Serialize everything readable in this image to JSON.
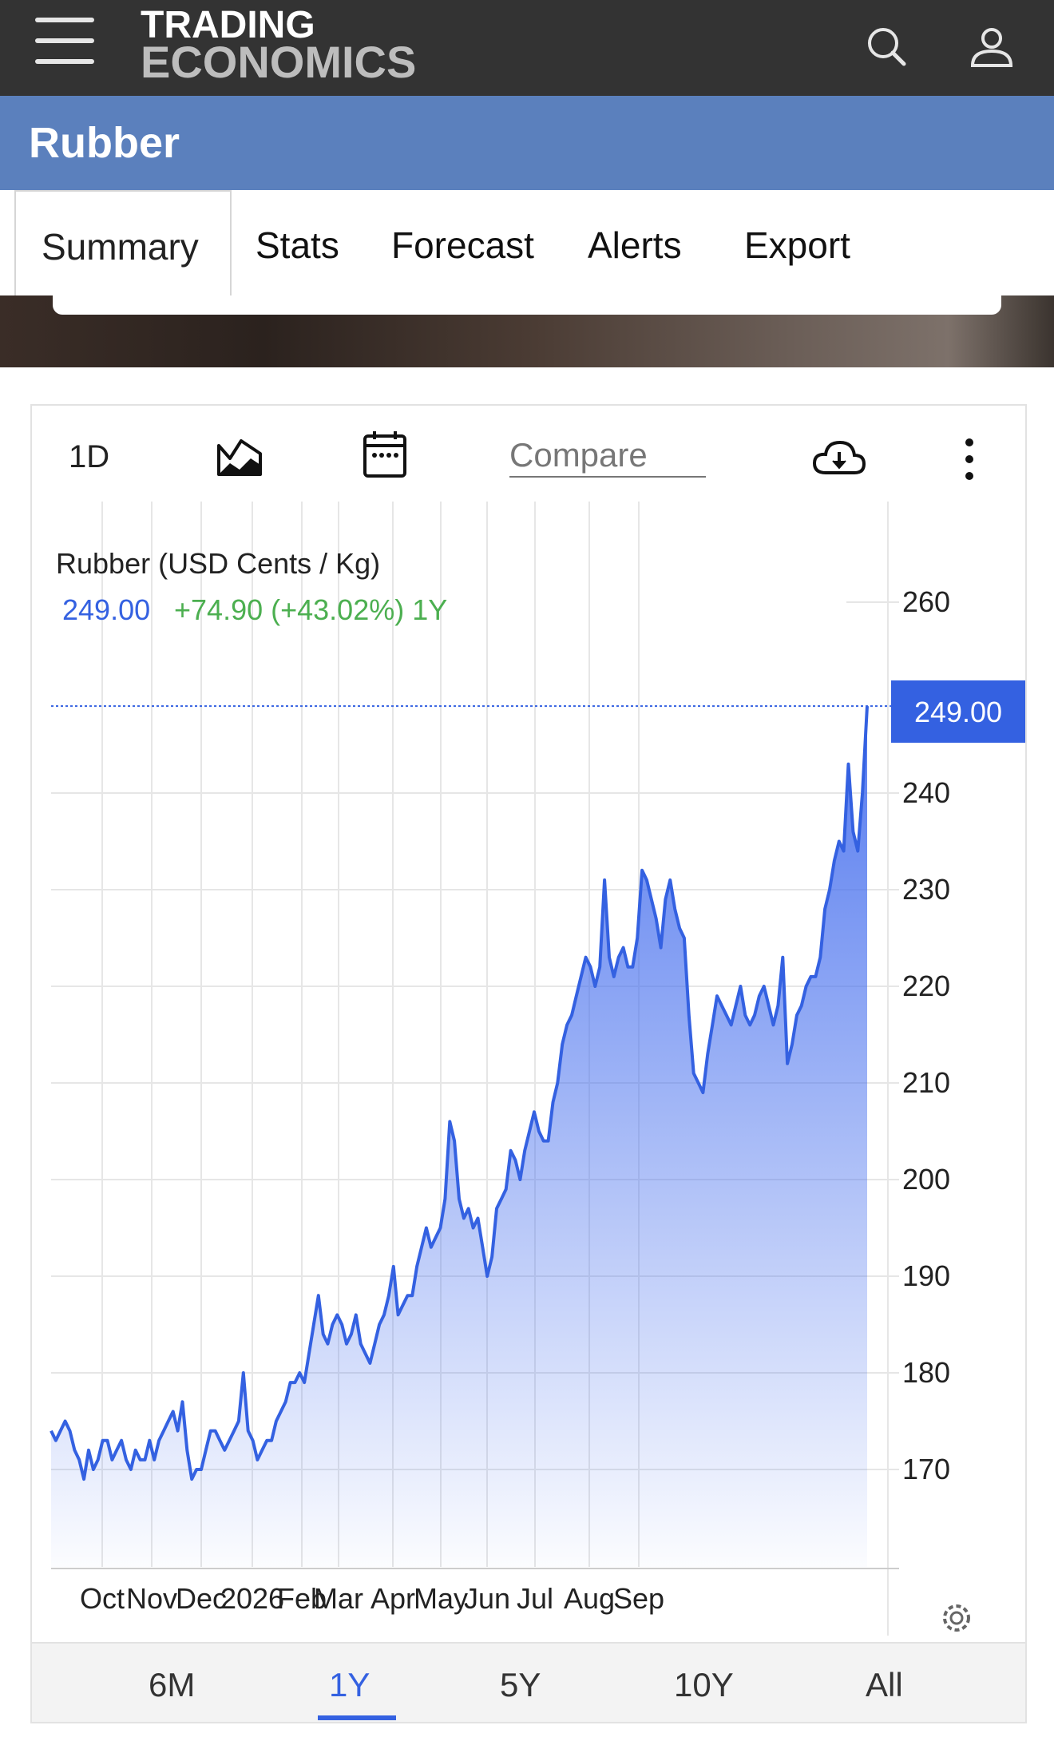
{
  "header": {
    "logo_line1": "TRADING",
    "logo_line2": "ECONOMICS"
  },
  "page_title": "Rubber",
  "tabs": [
    "Summary",
    "Stats",
    "Forecast",
    "Alerts",
    "Export"
  ],
  "toolbar": {
    "period_label": "1D",
    "compare_placeholder": "Compare"
  },
  "chart_info": {
    "series_name": "Rubber (USD Cents / Kg)",
    "last_value": "249.00",
    "change_text": "+74.90 (+43.02%) 1Y",
    "price_tag": "249.00"
  },
  "ranges": [
    "6M",
    "1Y",
    "5Y",
    "10Y",
    "All"
  ],
  "active_range": "1Y",
  "colors": {
    "accent": "#3461e1",
    "positive": "#4caf50",
    "title_bar": "#5b80bd"
  },
  "chart_data": {
    "type": "area",
    "title": "Rubber (USD Cents / Kg)",
    "xlabel": "",
    "ylabel": "",
    "x_ticks": [
      "Oct",
      "Nov",
      "Dec",
      "2026",
      "Feb",
      "Mar",
      "Apr",
      "May",
      "Jun",
      "Jul",
      "Aug",
      "Sep"
    ],
    "y_ticks": [
      170,
      180,
      190,
      200,
      210,
      220,
      230,
      240,
      260
    ],
    "ylim": [
      160,
      265
    ],
    "grid": true,
    "last_value": 249.0,
    "series": [
      {
        "values": [
          174,
          173,
          174,
          175,
          174,
          172,
          171,
          169,
          172,
          170,
          171,
          173,
          173,
          171,
          172,
          173,
          171,
          170,
          172,
          171,
          171,
          173,
          171,
          173,
          174,
          175,
          176,
          174,
          177,
          172,
          169,
          170,
          170,
          172,
          174,
          174,
          173,
          172,
          173,
          174,
          175,
          180,
          174,
          173,
          171,
          172,
          173,
          173,
          175,
          176,
          177,
          179,
          179,
          180,
          179,
          182,
          185,
          188,
          184,
          183,
          185,
          186,
          185,
          183,
          184,
          186,
          183,
          182,
          181,
          183,
          185,
          186,
          188,
          191,
          186,
          187,
          188,
          188,
          191,
          193,
          195,
          193,
          194,
          195,
          198,
          206,
          204,
          198,
          196,
          197,
          195,
          196,
          193,
          190,
          192,
          197,
          198,
          199,
          203,
          202,
          200,
          203,
          205,
          207,
          205,
          204,
          204,
          208,
          210,
          214,
          216,
          217,
          219,
          221,
          223,
          222,
          220,
          222,
          231,
          223,
          221,
          223,
          224,
          222,
          222,
          225,
          232,
          231,
          229,
          227,
          224,
          229,
          231,
          228,
          226,
          225,
          217,
          211,
          210,
          209,
          213,
          216,
          219,
          218,
          217,
          216,
          218,
          220,
          217,
          216,
          217,
          219,
          220,
          218,
          216,
          218,
          223,
          212,
          214,
          217,
          218,
          220,
          221,
          221,
          223,
          228,
          230,
          233,
          235,
          234,
          243,
          236,
          234,
          240,
          249
        ]
      }
    ]
  }
}
